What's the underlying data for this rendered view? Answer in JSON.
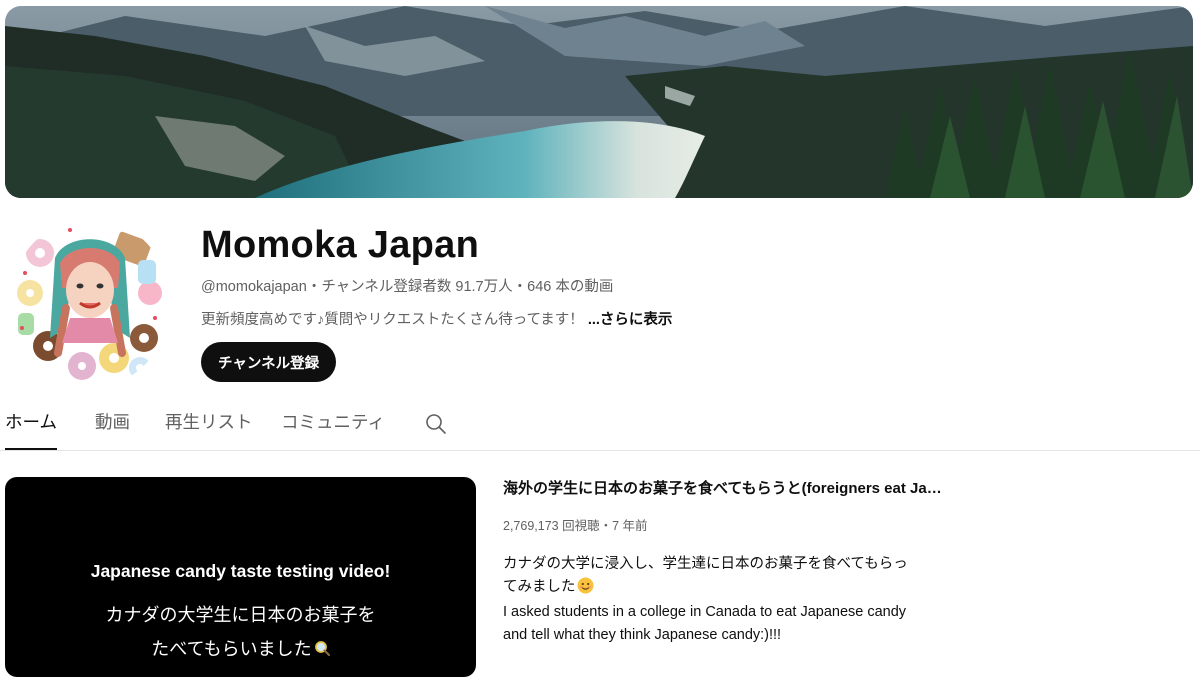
{
  "channel": {
    "name": "Momoka Japan",
    "handle": "@momokajapan",
    "subscribers": "チャンネル登録者数 91.7万人",
    "video_count": "646 本の動画",
    "separator": "・",
    "description": "更新頻度高めです♪質問やリクエストたくさん待ってます！",
    "more_label": "...さらに表示",
    "subscribe_label": "チャンネル登録"
  },
  "tabs": [
    {
      "label": "ホーム",
      "active": true
    },
    {
      "label": "動画",
      "active": false
    },
    {
      "label": "再生リスト",
      "active": false
    },
    {
      "label": "コミュニティ",
      "active": false
    }
  ],
  "search_icon": "search-icon",
  "featured": {
    "thumbnail": {
      "line1": "Japanese candy taste testing video!",
      "line2": "カナダの大学生に日本のお菓子を",
      "line3": "たべてもらいました"
    },
    "title": "海外の学生に日本のお菓子を食べてもらうと(foreigners eat Japanese candy)",
    "views": "2,769,173 回視聴",
    "age": "7 年前",
    "description_lines": [
      "カナダの大学に浸入し、学生達に日本のお菓子を食べてもらっ",
      "てみました",
      "I asked students in a college in Canada to eat Japanese candy",
      "and tell what they think Japanese candy:)!!!"
    ]
  },
  "colors": {
    "text_primary": "#0f0f0f",
    "text_secondary": "#606060",
    "button_bg": "#0f0f0f",
    "divider": "#e5e5e5"
  }
}
